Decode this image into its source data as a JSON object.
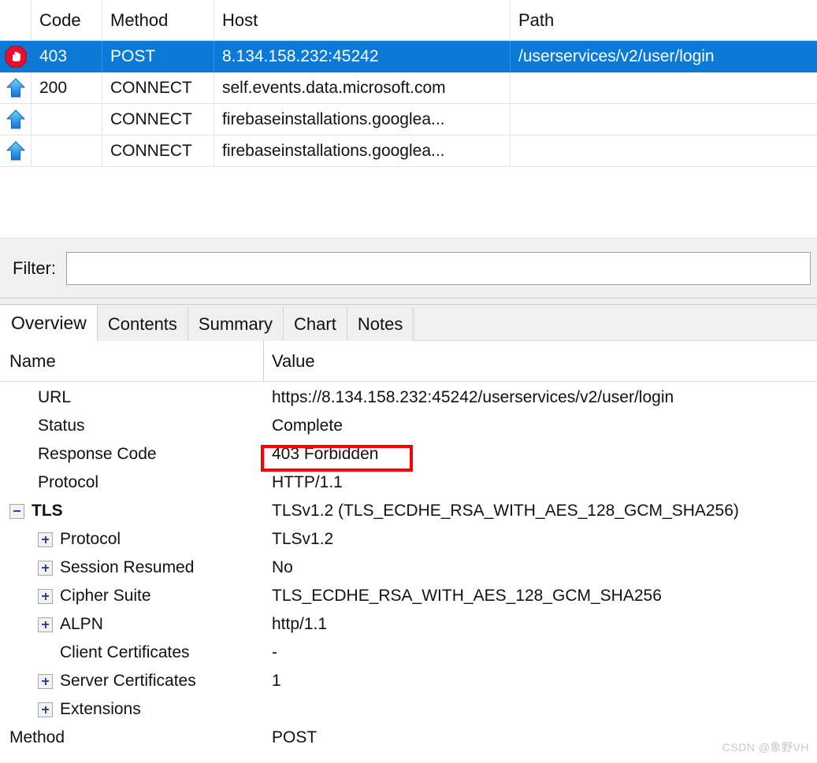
{
  "session_grid": {
    "columns": [
      "",
      "Code",
      "Method",
      "Host",
      "Path"
    ],
    "rows": [
      {
        "icon": "stop-hand-icon",
        "code": "403",
        "method": "POST",
        "host": "8.134.158.232:45242",
        "path": "/userservices/v2/user/login",
        "selected": true
      },
      {
        "icon": "blue-up-arrow-icon",
        "code": "200",
        "method": "CONNECT",
        "host": "self.events.data.microsoft.com",
        "path": "",
        "selected": false
      },
      {
        "icon": "blue-up-arrow-icon",
        "code": "",
        "method": "CONNECT",
        "host": "firebaseinstallations.googlea...",
        "path": "",
        "selected": false
      },
      {
        "icon": "blue-up-arrow-icon",
        "code": "",
        "method": "CONNECT",
        "host": "firebaseinstallations.googlea...",
        "path": "",
        "selected": false
      }
    ]
  },
  "filter": {
    "label": "Filter:",
    "value": "",
    "placeholder": ""
  },
  "tabs": [
    {
      "label": "Overview",
      "active": true
    },
    {
      "label": "Contents",
      "active": false
    },
    {
      "label": "Summary",
      "active": false
    },
    {
      "label": "Chart",
      "active": false
    },
    {
      "label": "Notes",
      "active": false
    }
  ],
  "detail": {
    "columns": {
      "name": "Name",
      "value": "Value"
    },
    "rows": [
      {
        "name": "URL",
        "value": "https://8.134.158.232:45242/userservices/v2/user/login",
        "toggle": "none",
        "level": 1,
        "bold": false
      },
      {
        "name": "Status",
        "value": "Complete",
        "toggle": "none",
        "level": 1,
        "bold": false
      },
      {
        "name": "Response Code",
        "value": "403 Forbidden",
        "toggle": "none",
        "level": 1,
        "bold": false
      },
      {
        "name": "Protocol",
        "value": "HTTP/1.1",
        "toggle": "none",
        "level": 1,
        "bold": false
      },
      {
        "name": "TLS",
        "value": "TLSv1.2 (TLS_ECDHE_RSA_WITH_AES_128_GCM_SHA256)",
        "toggle": "minus",
        "level": 0,
        "bold": true
      },
      {
        "name": "Protocol",
        "value": "TLSv1.2",
        "toggle": "plus",
        "level": 1,
        "bold": false
      },
      {
        "name": "Session Resumed",
        "value": "No",
        "toggle": "plus",
        "level": 1,
        "bold": false
      },
      {
        "name": "Cipher Suite",
        "value": "TLS_ECDHE_RSA_WITH_AES_128_GCM_SHA256",
        "toggle": "plus",
        "level": 1,
        "bold": false
      },
      {
        "name": "ALPN",
        "value": "http/1.1",
        "toggle": "plus",
        "level": 1,
        "bold": false
      },
      {
        "name": "Client Certificates",
        "value": "-",
        "toggle": "none",
        "level": 2,
        "bold": false
      },
      {
        "name": "Server Certificates",
        "value": "1",
        "toggle": "plus",
        "level": 1,
        "bold": false
      },
      {
        "name": "Extensions",
        "value": "",
        "toggle": "plus",
        "level": 1,
        "bold": false
      },
      {
        "name": "Method",
        "value": "POST",
        "toggle": "none",
        "level": 0,
        "bold": false
      }
    ]
  },
  "highlight": {
    "target_text": "403 Forbidden",
    "color": "#fb0000"
  },
  "watermark": "CSDN @象野VH",
  "colors": {
    "selection_blue": "#0a7ad6",
    "chrome_gray": "#f0f0f0",
    "highlight_red": "#fb0000",
    "arrow_blue": "#1e9bf0",
    "stop_red": "#e8102a"
  }
}
